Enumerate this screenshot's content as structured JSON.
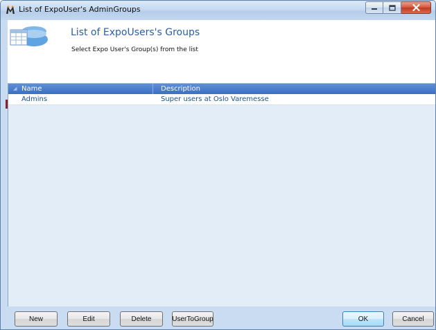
{
  "window": {
    "title": "List of ExpoUser's AdminGroups",
    "caption_buttons": [
      "minimize",
      "maximize",
      "close"
    ]
  },
  "header": {
    "title": "List of ExpoUsers's Groups",
    "subtitle": "Select Expo User's Group(s) from the list",
    "icon": "database-grid-icon"
  },
  "grid": {
    "columns": [
      "Name",
      "Description"
    ],
    "rows": [
      {
        "name": "Admins",
        "description": "Super users at Oslo Varemesse"
      }
    ]
  },
  "buttons": {
    "new": "New",
    "edit": "Edit",
    "delete": "Delete",
    "user_to_group": "UserToGroup",
    "ok": "OK",
    "cancel": "Cancel"
  },
  "colors": {
    "header_title": "#2a5db0",
    "grid_header": "#4a7fcf",
    "grid_background": "#e3edf8",
    "row_text": "#1a4f9c",
    "window_frame": "#c9dcf1"
  }
}
